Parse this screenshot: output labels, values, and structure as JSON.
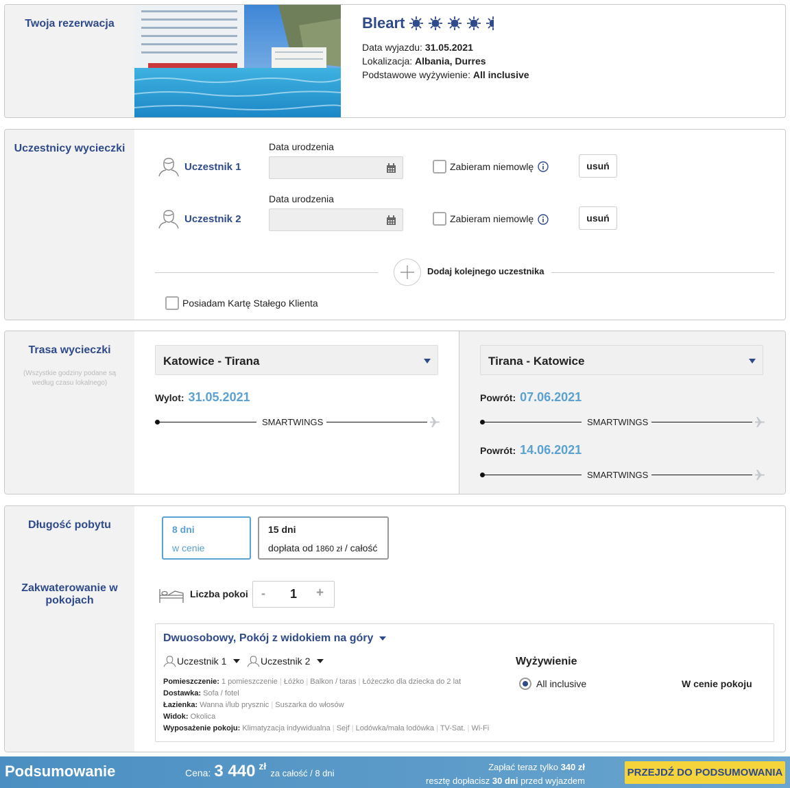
{
  "reservation": {
    "section_title": "Twoja rezerwacja",
    "hotel_name": "Bleart",
    "stars": 5,
    "departure_label": "Data wyjazdu:",
    "departure_value": "31.05.2021",
    "location_label": "Lokalizacja:",
    "location_value": "Albania, Durres",
    "board_label": "Podstawowe wyżywienie:",
    "board_value": "All inclusive"
  },
  "participants": {
    "section_title": "Uczestnicy wycieczki",
    "birth_label": "Data urodzenia",
    "infant_label": "Zabieram niemowlę",
    "remove_label": "usuń",
    "list": [
      {
        "name": "Uczestnik 1",
        "birth_value": ""
      },
      {
        "name": "Uczestnik 2",
        "birth_value": ""
      }
    ],
    "add_label": "Dodaj kolejnego uczestnika",
    "loyalty_label": "Posiadam Kartę Stałego Klienta"
  },
  "route": {
    "section_title": "Trasa wycieczki",
    "note": "(Wszystkie godziny podane są według czasu lokalnego)",
    "outbound": {
      "select_value": "Katowice - Tirana",
      "label": "Wylot:",
      "date": "31.05.2021",
      "airline": "SMARTWINGS"
    },
    "return": {
      "select_value": "Tirana - Katowice",
      "options": [
        {
          "label": "Powrót:",
          "date": "07.06.2021",
          "airline": "SMARTWINGS"
        },
        {
          "label": "Powrót:",
          "date": "14.06.2021",
          "airline": "SMARTWINGS"
        }
      ]
    }
  },
  "stay": {
    "section_title": "Długość pobytu",
    "options": [
      {
        "days": "8 dni",
        "price_text": "w cenie",
        "selected": true
      },
      {
        "days": "15 dni",
        "price_prefix": "dopłata od",
        "price_amount": "1860 zł",
        "price_suffix": "/ całość",
        "selected": false
      }
    ]
  },
  "accommodation": {
    "section_title": "Zakwaterowanie w pokojach",
    "rooms_label": "Liczba pokoi",
    "rooms_minus": "-",
    "rooms_value": "1",
    "rooms_plus": "+",
    "room_type": "Dwuosobowy, Pokój z widokiem na góry",
    "occupants": [
      "Uczestnik 1",
      "Uczestnik 2"
    ],
    "details": [
      {
        "label": "Pomieszczenie:",
        "items": [
          "1 pomieszczenie",
          "Łóżko",
          "Balkon / taras",
          "Łóżeczko dla dziecka do 2 lat"
        ]
      },
      {
        "label": "Dostawka:",
        "items": [
          "Sofa / fotel"
        ]
      },
      {
        "label": "Łazienka:",
        "items": [
          "Wanna i/lub prysznic",
          "Suszarka do włosów"
        ]
      },
      {
        "label": "Widok:",
        "items": [
          "Okolica"
        ]
      },
      {
        "label": "Wyposażenie pokoju:",
        "items": [
          "Klimatyzacja indywidualna",
          "Sejf",
          "Lodówka/mała lodówka",
          "TV-Sat.",
          "Wi-Fi"
        ]
      }
    ],
    "board_title": "Wyżywienie",
    "board_option": "All inclusive",
    "board_price": "W cenie pokoju"
  },
  "footer": {
    "title": "Podsumowanie",
    "price_label": "Cena:",
    "price_value": "3 440",
    "price_currency": "zł",
    "price_suffix": "za całość / 8 dni",
    "pay_now_prefix": "Zapłać teraz tylko",
    "pay_now_amount": "340 zł",
    "pay_rest_prefix": "resztę dopłacisz",
    "pay_rest_days": "30 dni",
    "pay_rest_suffix": "przed wyjazdem",
    "cta_label": "PRZEJDŹ DO PODSUMOWANIA"
  },
  "colors": {
    "brand_blue": "#2f4a8a",
    "link_blue": "#5aa0d0",
    "cta_yellow": "#f5d33b",
    "footer_blue": "#5596c6"
  },
  "icons": [
    "sun-icon",
    "user-icon",
    "calendar-icon",
    "info-icon",
    "plus-circle-icon",
    "plane-icon",
    "dropdown-arrow-icon",
    "bed-icon"
  ]
}
